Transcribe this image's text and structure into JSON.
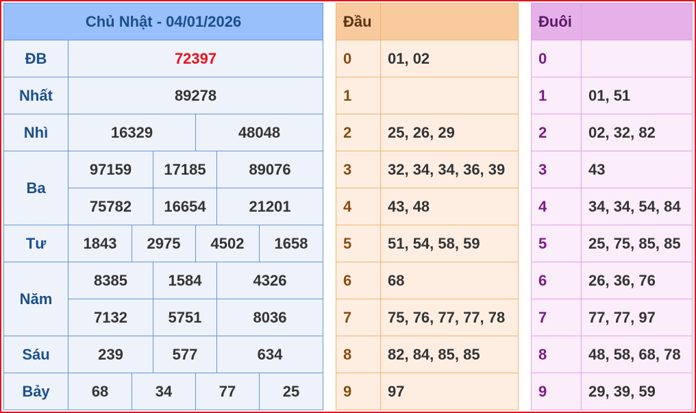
{
  "main": {
    "title": "Chủ Nhật - 04/01/2026",
    "prizes": [
      {
        "label": "ĐB",
        "rows": [
          [
            "72397"
          ]
        ]
      },
      {
        "label": "Nhất",
        "rows": [
          [
            "89278"
          ]
        ]
      },
      {
        "label": "Nhì",
        "rows": [
          [
            "16329",
            "48048"
          ]
        ]
      },
      {
        "label": "Ba",
        "rows": [
          [
            "97159",
            "17185",
            "89076"
          ],
          [
            "75782",
            "16654",
            "21201"
          ]
        ]
      },
      {
        "label": "Tư",
        "rows": [
          [
            "1843",
            "2975",
            "4502",
            "1658"
          ]
        ]
      },
      {
        "label": "Năm",
        "rows": [
          [
            "8385",
            "1584",
            "4326"
          ],
          [
            "7132",
            "5751",
            "8036"
          ]
        ]
      },
      {
        "label": "Sáu",
        "rows": [
          [
            "239",
            "577",
            "634"
          ]
        ]
      },
      {
        "label": "Bảy",
        "rows": [
          [
            "68",
            "34",
            "77",
            "25"
          ]
        ]
      }
    ]
  },
  "dau": {
    "header": "Đầu",
    "rows": [
      {
        "key": "0",
        "values": "01, 02"
      },
      {
        "key": "1",
        "values": ""
      },
      {
        "key": "2",
        "values": "25, 26, 29"
      },
      {
        "key": "3",
        "values": "32, 34, 34, 36, 39"
      },
      {
        "key": "4",
        "values": "43, 48"
      },
      {
        "key": "5",
        "values": "51, 54, 58, 59"
      },
      {
        "key": "6",
        "values": "68"
      },
      {
        "key": "7",
        "values": "75, 76, 77, 77, 78"
      },
      {
        "key": "8",
        "values": "82, 84, 85, 85"
      },
      {
        "key": "9",
        "values": "97"
      }
    ]
  },
  "duoi": {
    "header": "Đuôi",
    "rows": [
      {
        "key": "0",
        "values": ""
      },
      {
        "key": "1",
        "values": "01, 51"
      },
      {
        "key": "2",
        "values": "02, 32, 82"
      },
      {
        "key": "3",
        "values": "43"
      },
      {
        "key": "4",
        "values": "34, 34, 54, 84"
      },
      {
        "key": "5",
        "values": "25, 75, 85, 85"
      },
      {
        "key": "6",
        "values": "26, 36, 76"
      },
      {
        "key": "7",
        "values": "77, 77, 97"
      },
      {
        "key": "8",
        "values": "48, 58, 68, 78"
      },
      {
        "key": "9",
        "values": "29, 39, 59"
      }
    ]
  },
  "colors": {
    "frame_border": "#e8121a",
    "main_header_bg": "#99c0fb",
    "main_label": "#1c4f8a",
    "special_prize": "#e8121a",
    "dau_header_bg": "#f9ca9e",
    "duoi_header_bg": "#e6b0e8"
  }
}
